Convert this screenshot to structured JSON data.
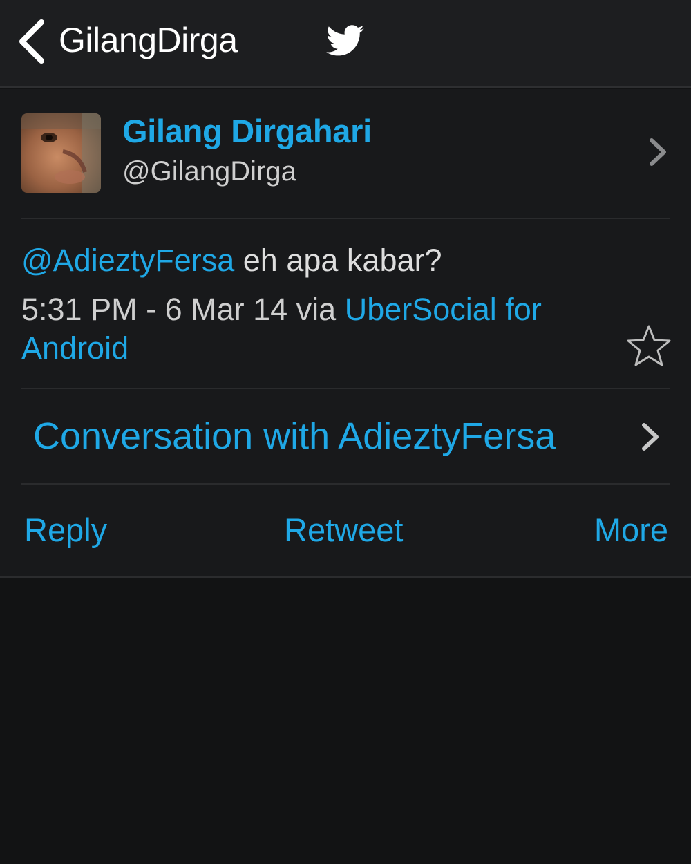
{
  "nav": {
    "title": "GilangDirga",
    "back_icon": "chevron-left-icon",
    "logo_icon": "twitter-bird-icon"
  },
  "author": {
    "name": "Gilang Dirgahari",
    "handle": "@GilangDirga"
  },
  "tweet": {
    "mention": "@AdieztyFersa",
    "body": " eh apa kabar?",
    "timestamp": "5:31 PM - 6 Mar 14 via ",
    "source": "UberSocial for Android"
  },
  "conversation": {
    "label": "Conversation with AdieztyFersa"
  },
  "actions": {
    "reply": "Reply",
    "retweet": "Retweet",
    "more": "More"
  },
  "colors": {
    "accent": "#1fa8e6",
    "background": "#121314",
    "navbar": "#1d1e20",
    "card": "#18191b",
    "text": "#dedede"
  }
}
